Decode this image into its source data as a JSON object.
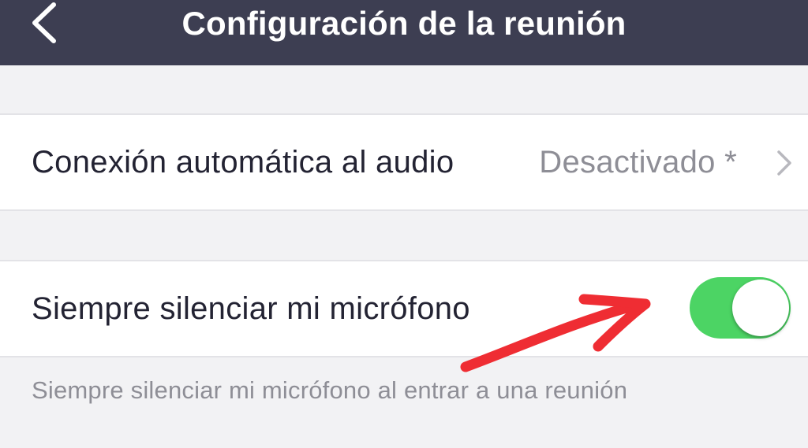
{
  "header": {
    "title": "Configuración de la reunión",
    "back_icon": "chevron-left-icon",
    "background_color": "#3d3e52"
  },
  "settings": {
    "auto_audio": {
      "label": "Conexión automática al audio",
      "value": "Desactivado *",
      "chevron_icon": "chevron-right-icon"
    },
    "always_mute": {
      "label": "Siempre silenciar mi micrófono",
      "toggle_on": true,
      "toggle_color": "#4cd464"
    },
    "always_mute_description": "Siempre silenciar mi micrófono al entrar a una reunión"
  },
  "annotation": {
    "type": "red-arrow",
    "color": "#ef2d33",
    "points_to": "always-mute-toggle"
  }
}
